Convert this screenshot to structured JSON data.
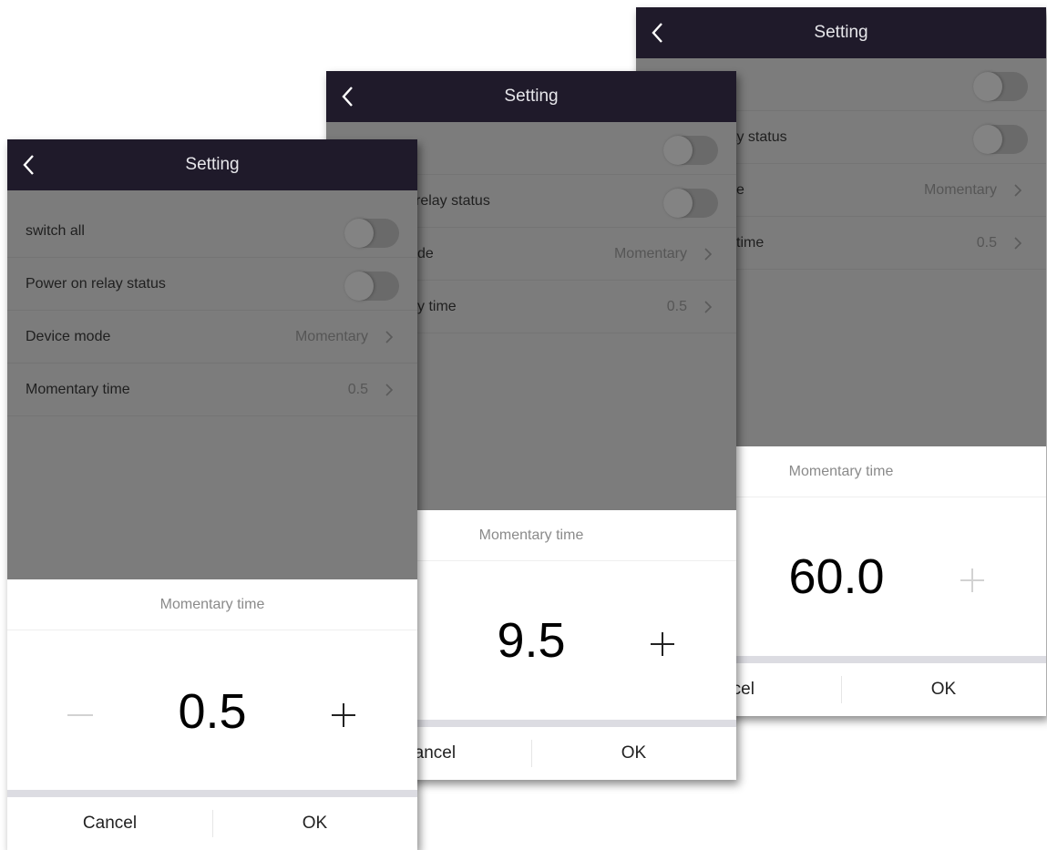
{
  "screens": [
    {
      "header": {
        "title": "Setting",
        "back_icon": "chevron-left-icon"
      },
      "settings": {
        "switch_all_label": "switch all",
        "power_on_label": "Power on relay status",
        "device_mode_label": "Device mode",
        "device_mode_value": "Momentary",
        "momentary_time_label": "Momentary time",
        "momentary_time_value": "0.5"
      },
      "dialog": {
        "title": "Momentary time",
        "value": "0.5",
        "cancel_label": "Cancel",
        "ok_label": "OK"
      }
    },
    {
      "header": {
        "title": "Setting",
        "back_icon": "chevron-left-icon"
      },
      "settings": {
        "power_on_label": "relay status",
        "device_mode_label": "de",
        "device_mode_value": "Momentary",
        "momentary_time_label": "y time",
        "momentary_time_value": "0.5"
      },
      "dialog": {
        "title": "Momentary time",
        "value": "9.5",
        "cancel_label": "Cancel",
        "ok_label": "OK"
      }
    },
    {
      "header": {
        "title": "Setting",
        "back_icon": "chevron-left-icon"
      },
      "settings": {
        "power_on_label": "lay status",
        "device_mode_label": "e",
        "device_mode_value": "Momentary",
        "momentary_time_label": "time",
        "momentary_time_value": "0.5"
      },
      "dialog": {
        "title": "Momentary time",
        "value": "60.0",
        "cancel_label": "ncel",
        "ok_label": "OK"
      }
    }
  ],
  "colors": {
    "header_bg": "#1f1a2a",
    "overlay_bg": "#7c7c7c",
    "sheet_bg": "#ffffff",
    "divider_bar": "#dcdce2",
    "disabled_icon": "#d2d2d2"
  }
}
